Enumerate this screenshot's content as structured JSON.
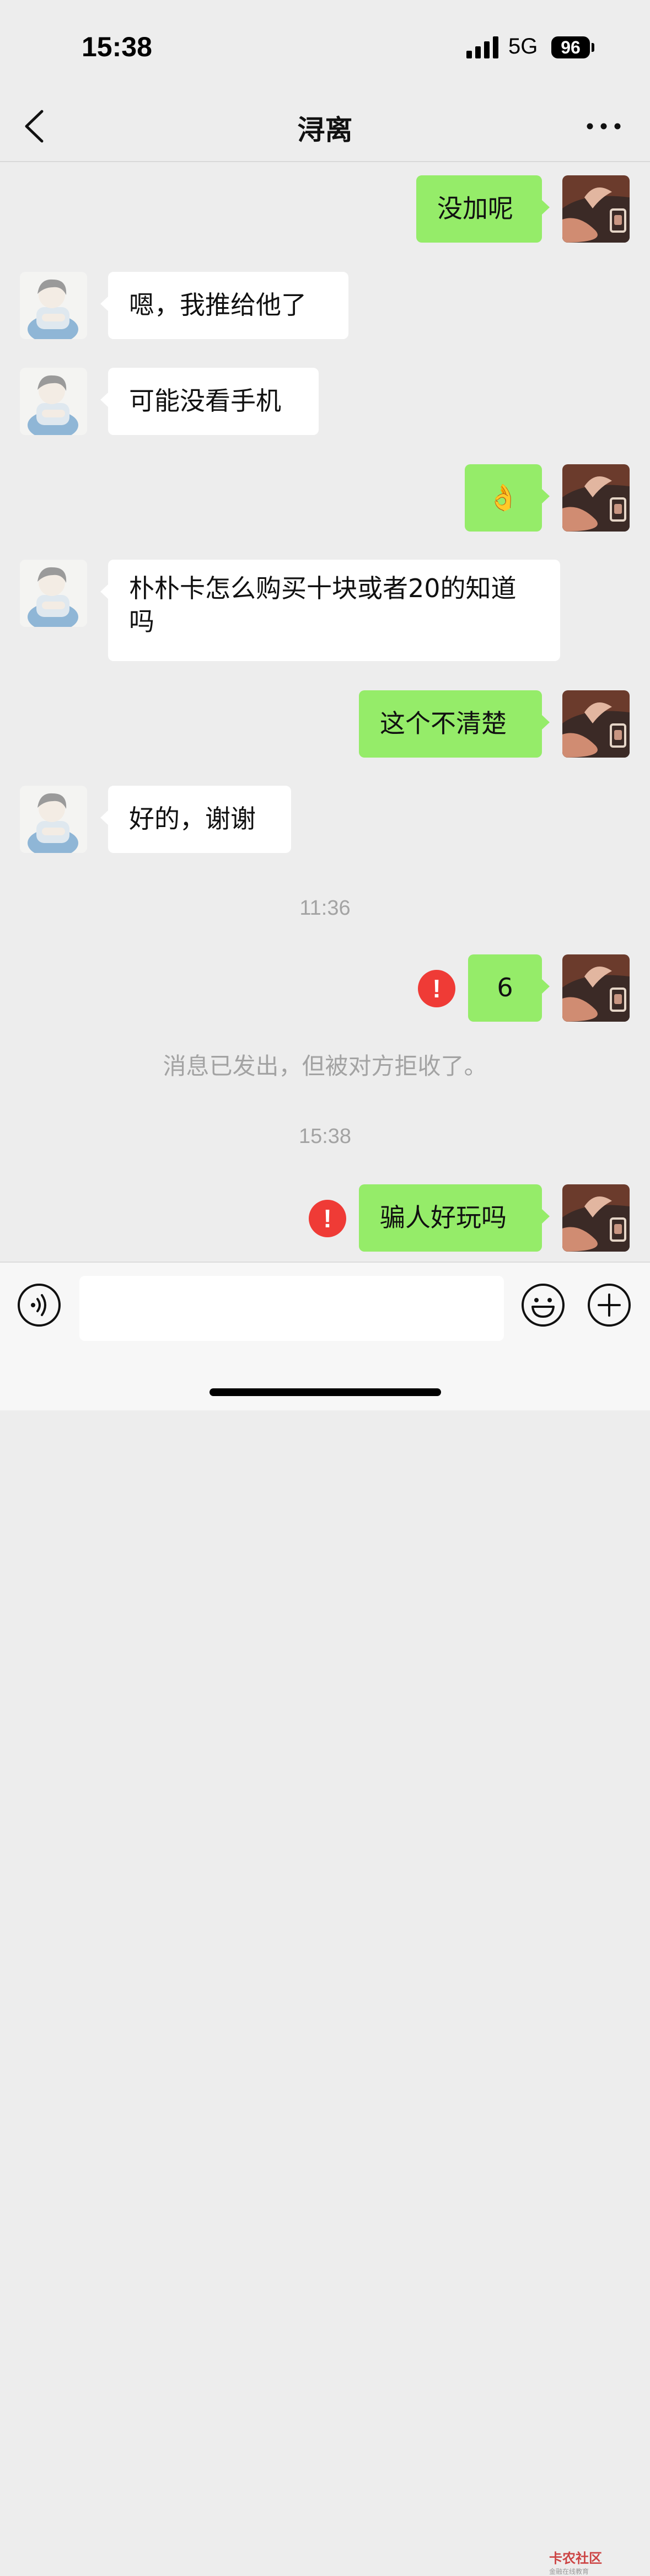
{
  "status": {
    "time": "15:38",
    "network": "5G",
    "battery": "96"
  },
  "header": {
    "title": "浔离"
  },
  "messages": [
    {
      "text": "没加呢"
    },
    {
      "text": "嗯，我推给他了"
    },
    {
      "text": "可能没看手机"
    },
    {
      "text": "👌"
    },
    {
      "text": "朴朴卡怎么购买十块或者20的知道吗"
    },
    {
      "text": "这个不清楚"
    },
    {
      "text": "好的，谢谢"
    },
    {
      "text": "6"
    },
    {
      "text": "骗人好玩吗"
    }
  ],
  "timestamps": [
    "11:36",
    "15:38"
  ],
  "system_note": "消息已发出，但被对方拒收了。",
  "error_mark": "!",
  "watermark": {
    "line1": "卡农社区",
    "line2": "金融在线教育"
  },
  "colors": {
    "bg": "#ededed",
    "sent_bubble": "#95ec69",
    "received_bubble": "#ffffff",
    "error": "#ef3b36"
  }
}
